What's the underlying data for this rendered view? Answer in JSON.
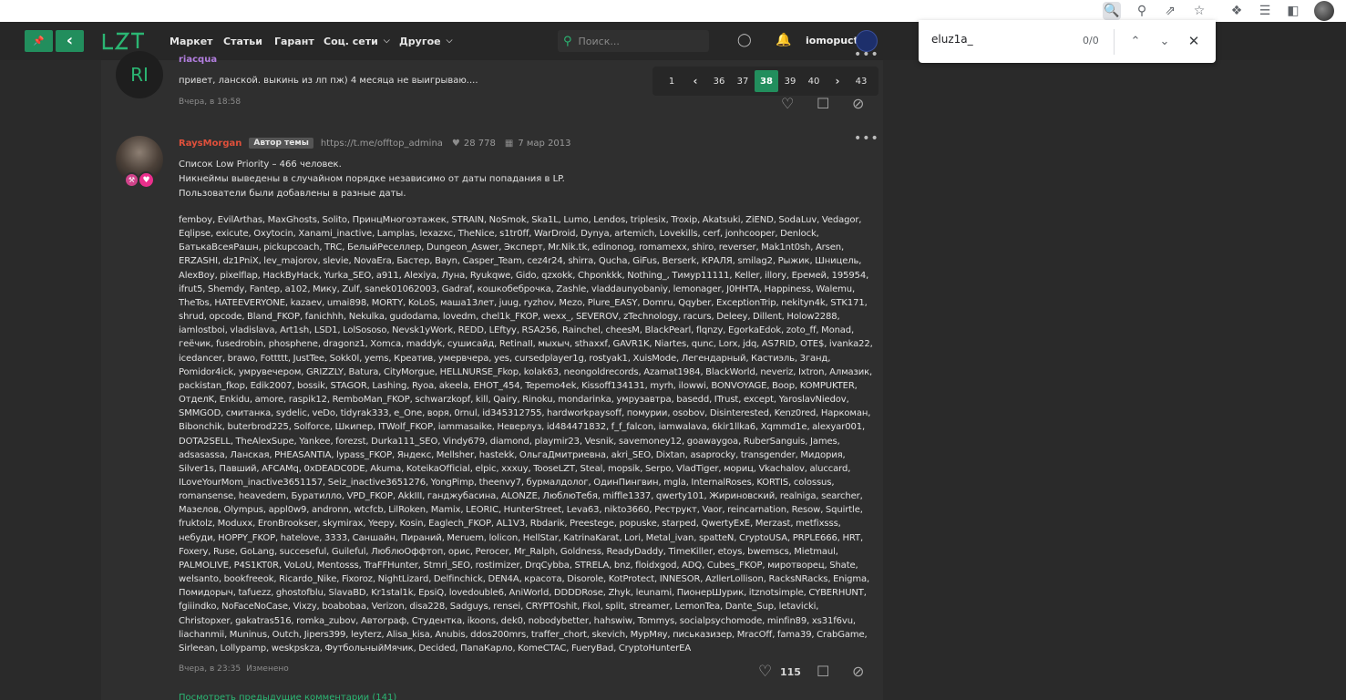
{
  "browser": {
    "toolbar_icons": [
      "find-in-page-icon",
      "zoom-icon",
      "share-icon",
      "bookmark-star-icon",
      "extensions-icon",
      "reading-list-icon",
      "side-panel-icon"
    ]
  },
  "header": {
    "pin_glyph": "📌",
    "back_glyph": "‹",
    "logo": "LZT",
    "nav": [
      "Маркет",
      "Статьи",
      "Гарант",
      "Соц. сети",
      "Другое"
    ],
    "search_placeholder": "Поиск...",
    "username": "iomopuct"
  },
  "findbar": {
    "query": "eluz1a_",
    "count": "0/0"
  },
  "pagination": {
    "pages": [
      "1",
      "36",
      "37",
      "38",
      "39",
      "40",
      "43"
    ],
    "current": "38"
  },
  "comment1": {
    "avatar_text": "RI",
    "author": "riacqua",
    "text": "привет, ланской. выкинь из лп пж) 4 месяца не выигрываю....",
    "time": "Вчера, в 18:58"
  },
  "post": {
    "author": "RaysMorgan",
    "tag": "Автор темы",
    "link": "https://t.me/offtop_admina",
    "likes_total": "28 778",
    "joined": "7 мар 2013",
    "intro": [
      "Список Low Priority – 466 человек.",
      "Никнеймы выведены в случайном порядке независимо от даты попадания в LP.",
      "Пользователи были добавлены в разные даты."
    ],
    "names": "femboy, EvilArthas, MaxGhosts, Solito, ПринцМногоэтажек, STRAIN, NoSmok, Ska1L, Lumo, Lendos, triplesix, Troxip, Akatsuki, ZiEND, SodaLuv, Vedagor, Eqlipse, exicute, Oxytocin, Xanami_inactive, Lamplas, lexazxc, TheNice, s1tr0ff, WarDroid, Dynya, artemich, Lovekills, cerf, jonhcooper, Denlock, БатькаВсеяРашн, pickupcoach, TRC, БелыйРеселлер, Dungeon_Aswer, Эксперт, Mr.Nik.tk, edinonog, romamexx, shiro, reverser, Mak1nt0sh, Arsen, ERZASHI, dz1PniX, lev_majorov, slevie, NovaEra, Бастер, Bayn, Casper_Team, cez4r24, shirra, Qucha, GiFus, Berserk, КРАЛЯ, smilag2, Рыжик, Шницель, AlexBoy, pixelflap, HackByHack, Yurka_SEO, a911, Alexiya, Луна, Ryukqwe, Gido, qzxokk, Chponkkk, Nothing_, Тимур11111, Keller, illory, Еремей, 195954, ifrut5, Shemdy, Fantep, a102, Мику, Zulf, sanek01062003, Gadraf, кошкобеброчка, Zashle, vladdaunyobaniy, lemonager, J0HHTA, Happiness, Walemu, TheTos, HATEEVERYONE, kazaev, umai898, MORTY, KoLoS, маша13лет, juug, ryzhov, Mezo, Plure_EASY, Domru, Qqyber, ExceptionTrip, nekityn4k, STK171, shrud, opcode, Bland_FKOP, fanichhh, Nekulka, gudodama, lovedm, chel1k_FKOP, wexx_, SEVEROV, zTechnology, racurs, Deleey, Dillent, Holow2288, iamlostboi, vladislava, Art1sh, LSD1, LolSososo, Nevsk1yWork, REDD, LEftyy, RSA256, Rainchel, cheesM, BlackPearl, flqnzy, EgorkaEdok, zoto_ff, Monad, геёчик, fusedrobin, phosphene, dragonz1, Хomca, maddyk, сушисайд, RetinaII, мыхыч, sthaxxf, GAVR1K, Niartes, qunc, Lorx, jdq, AS7RID, OTE$, ivanka22, icedancer, brawo, Fottttt, JustTee, Sokk0l, yems, Креатив, умервчера, yes, cursedplayer1g, rostyak1, XuisMode, Легендарный, Кастиэль, 3ганд, Pomidor4ick, умрувечером, GRIZZLY, Batura, CityMorgue, HELLNURSE_Fkop, kolak63, neongoldrecords, Azamat1984, BlackWorld, neveriz, Ixtron, Алмазик, packistan_fkop, Edik2007, bossik, STAGOR, Lashing, Ryoa, akeela, EHOT_454, Tepemo4ek, Kissoff134131, myrh, ilowwi, BONVOYAGE, Boop, KOMPUKTER, ОтделK, Enkidu, amore, raspik12, RemboMan_FKOP, schwarzkopf, kill, Qairy, Rinoku, mondarinka, умрузавтра, basedd, ITrust, except, YaroslavNiedov, SMMGOD, смитанка, sydelic, veDo, tidyrak333, e_One, воря, 0rnul, id345312755, hardworkpaysoff, помурии, osobov, Disinterested, Kenz0red, Наркоман, Bibonchik, buterbrod225, Solforce, Шкипер, ITWolf_FKOP, iammasaike, Неверлуз, id484471832, f_f_falcon, iamwalava, 6kir1llka6, Xqmmd1e, alexyar001, DOTA2SELL, TheAlexSupe, Yankee, forezst, Durka111_SEO, Vindy679, diamond, playmir23, Vesnik, savemoney12, goawaygoa, RuberSanguis, James, adsasassa, Ланская, PHEASANTIA, lypass_FKOP, Яндекс, Mellsher, hastekk, ОльгаДмитриевна, akri_SEO, Dixtan, asaprocky, transgender, Мидория, Silver1s, Павший, AFCAMq, 0xDEADC0DE, Akuma, KoteikaOfficial, elpic, xxxuy, TooseLZT, Steal, mopsik, Serpo, VladTiger, мориц, Vkachalov, aluccard, ILoveYourMom_inactive3651157, Seiz_inactive3651276, YongPimp, theenvy7, бурмалдолог, ОдинПингвин, mgla, InternalRoses, KORTIS, colossus, romansense, heavedem, Буратилло, VPD_FKOP, AkkIII, ганджубасина, ALONZE, ЛюблюТебя, miffle1337, qwerty101, Жириновский, realniga, searcher, Мазелов, Olympus, appl0w9, andronn, wtcfcb, LilRoken, Mamix, LEORIC, HunterStreet, Leva63, nikto3660, Реструкт, Vaor, reincarnation, Resow, Squirtle, fruktolz, Moduxx, EronBrookser, skymirax, Yeepy, Kosin, Eaglech_FKOP, AL1V3, Rbdarik, Preestege, popuske, starped, QwertyExE, Merzast, metfixsss, небуди, HOPPY_FKOP, hatelove, 3333, Саншайн, Пираний, Meruem, lolicon, HellStar, KatrinaKarat, Lori, Metal_ivan, spatteN, CryptoUSA, PRPLE666, HRT, Foxery, Ruse, GoLang, succeseful, Guileful, ЛюблюОффтоп, орис, Perocer, Mr_Ralph, Goldness, ReadyDaddy, TimeKiller, etoys, bwemscs, Mietmaul, PALMOLIVE, P4S1KT0R, VoLoU, Mentosss, TraFFHunter, Stmri_SEO, rostimizer, DrqCybba, STRELA, bnz, floidxgod, ADQ, Cubes_FKOP, миротворец, Shate, welsanto, bookfreeok, Ricardo_Nike, Fixoroz, NightLizard, Delfinchick, DEN4A, красота, Disorole, KotProtect, INNESOR, AzllerLollison, RacksNRacks, Enigma, Помидорыч, tafuezz, ghostofblu, SlavaBD, Kr1stal1k, EpsiQ, lovedouble6, AniWorld, DDDDRose, Zhyk, leunami, ПионерШурик, itznotsimple, CYBERHUNT, fgiiindko, NoFaceNoCase, Vixzy, boabobaa, Verizon, disa228, Sadguys, rensei, CRYPTOshit, Fkol, split, streamer, LemonTea, Dante_Sup, letavicki, Christopxer, gakatras516, romka_zubov, Автограф, Студентка, ikoons, dek0, nobodybetter, hahswiw, Tommys, socialpsychomode, minfin89, xs31f6vu, liachanmii, Muninus, Outch, Jipers399, leyterz, Alisa_kisa, Anubis, ddos200mrs, traffer_chort, skevich, МурМяу, письказизер, MracOff, fama39, CrabGame, Sirleean, Lollypamp, weskpskza, ФутбольныйМячик, Decided, ПапаКарло, KomeCTAC, FueryBad, CryptoHunterEA",
    "time": "Вчера, в 23:35",
    "edited": "Изменено",
    "like_count": "115",
    "more_comments": "Посмотреть предыдущие комментарии (141)"
  },
  "colors": {
    "accent": "#228e5d",
    "accent_text": "#2bb673",
    "author_red": "#e0503b",
    "commenter_purple": "#b37fe0"
  }
}
